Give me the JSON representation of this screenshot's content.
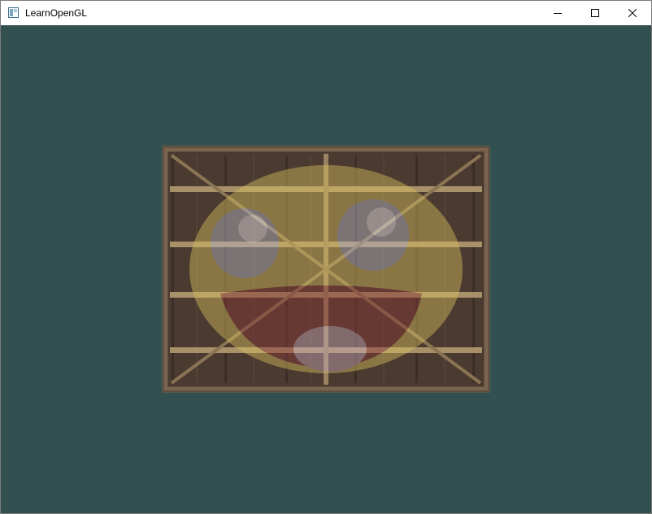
{
  "window": {
    "title": "LearnOpenGL",
    "controls": {
      "minimize": "minimize",
      "maximize": "maximize",
      "close": "close"
    }
  },
  "scene": {
    "clear_color": "#335050",
    "crate_wood": "#4a3a30",
    "crate_plank_light": "#a89068",
    "crate_frame": "#7a6450",
    "face_yellow": "#d8c060",
    "face_mouth": "#8a3838",
    "face_eye": "#b8b8c8",
    "face_tongue": "#c8a8b8",
    "mix_level": 0.45
  },
  "icons": {
    "app": "window-app-icon",
    "minimize": "minimize-icon",
    "maximize": "maximize-icon",
    "close": "close-icon"
  }
}
